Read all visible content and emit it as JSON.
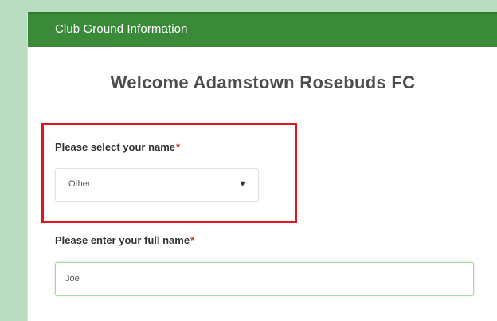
{
  "header": {
    "title": "Club Ground Information"
  },
  "welcome": {
    "text": "Welcome Adamstown Rosebuds FC"
  },
  "form": {
    "name_select": {
      "label": "Please select your name",
      "required_mark": "*",
      "value": "Other",
      "caret": "▼"
    },
    "full_name": {
      "label": "Please enter your full name",
      "required_mark": "*",
      "value": "Joe"
    }
  },
  "colors": {
    "header_bg": "#3b8a3a",
    "page_bg": "#b9dcc0",
    "highlight_border": "#e0161e",
    "input_focus_border": "#a8d8a8"
  }
}
